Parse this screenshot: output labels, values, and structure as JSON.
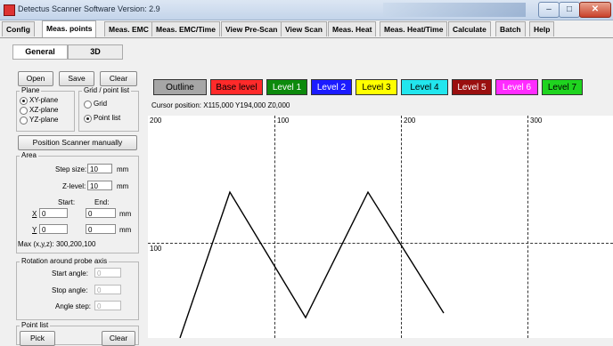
{
  "window": {
    "title": "Detectus Scanner Software Version: 2.9",
    "buttons": {
      "minimize": "–",
      "maximize": "□",
      "close": "✕"
    }
  },
  "tabs": [
    {
      "label": "Config"
    },
    {
      "label": "Meas. points"
    },
    {
      "label": "Meas. EMC"
    },
    {
      "label": "Meas. EMC/Time"
    },
    {
      "label": "View Pre-Scan"
    },
    {
      "label": "View Scan"
    },
    {
      "label": "Meas. Heat"
    },
    {
      "label": "Meas. Heat/Time"
    },
    {
      "label": "Calculate"
    },
    {
      "label": "Batch"
    },
    {
      "label": "Help"
    }
  ],
  "active_tab": "Meas. points",
  "subtabs": [
    {
      "label": "General"
    },
    {
      "label": "3D"
    }
  ],
  "toolbar": {
    "open": "Open",
    "save": "Save",
    "clear": "Clear"
  },
  "plane": {
    "title": "Plane",
    "options": [
      "XY-plane",
      "XZ-plane",
      "YZ-plane"
    ],
    "selected": "XY-plane"
  },
  "grid_mode": {
    "title": "Grid / point list",
    "options": [
      "Grid",
      "Point list"
    ],
    "selected": "Point list"
  },
  "position_manually": "Position Scanner manually",
  "area": {
    "title": "Area",
    "step_size_label": "Step size:",
    "step_size": "10",
    "step_unit": "mm",
    "z_level_label": "Z-level:",
    "z_level": "10",
    "z_unit": "mm",
    "start_label": "Start:",
    "end_label": "End:",
    "x_label": "X",
    "x_start": "0",
    "x_end": "0",
    "x_unit": "mm",
    "y_label": "Y",
    "y_start": "0",
    "y_end": "0",
    "y_unit": "mm",
    "max_text": "Max (x,y,z): 300,200,100"
  },
  "rotation": {
    "title": "Rotation around probe axis",
    "start_label": "Start angle:",
    "start": "0",
    "stop_label": "Stop angle:",
    "stop": "0",
    "step_label": "Angle step:",
    "step": "0"
  },
  "point_list": {
    "title": "Point list",
    "add": "Pick",
    "clear": "Clear"
  },
  "levels": [
    {
      "label": "Outline",
      "bg": "#a6a6a6",
      "fg": "#000000"
    },
    {
      "label": "Base level",
      "bg": "#ff2a2a",
      "fg": "#000000"
    },
    {
      "label": "Level 1",
      "bg": "#0d8a0d",
      "fg": "#ffffff"
    },
    {
      "label": "Level 2",
      "bg": "#1b1bff",
      "fg": "#ffffff"
    },
    {
      "label": "Level 3",
      "bg": "#ffff00",
      "fg": "#000000"
    },
    {
      "label": "Level 4",
      "bg": "#22e6ee",
      "fg": "#000000"
    },
    {
      "label": "Level 5",
      "bg": "#9a0f0f",
      "fg": "#ffffff"
    },
    {
      "label": "Level 6",
      "bg": "#ff2bff",
      "fg": "#ffffff"
    },
    {
      "label": "Level 7",
      "bg": "#1fd41f",
      "fg": "#000000"
    }
  ],
  "cursor_position": "Cursor position: X115,000 Y194,000 Z0,000",
  "plot": {
    "x_ticks": [
      "200",
      "100",
      "200",
      "300"
    ],
    "y_ticks": [
      "100"
    ],
    "path_points": [
      [
        140,
        470
      ],
      [
        92,
        80
      ],
      [
        177,
        227
      ],
      [
        247,
        80
      ],
      [
        332,
        222
      ]
    ],
    "line_color": "#000000"
  }
}
